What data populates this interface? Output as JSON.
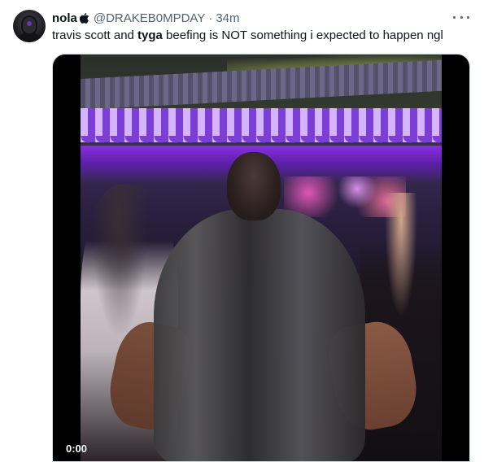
{
  "tweet": {
    "display_name": "nola",
    "badge_icon": "apple-icon",
    "handle": "@DRAKEB0MPDAY",
    "separator": "·",
    "time": "34m",
    "text_before": "travis scott and ",
    "text_bold": "tyga",
    "text_after": " beefing is NOT something i expected to happen ngl",
    "more_icon": "more-horizontal-icon"
  },
  "video": {
    "timestamp": "0:00"
  },
  "colors": {
    "text_primary": "#0f1419",
    "text_secondary": "#536471",
    "border": "#cfd9de",
    "video_bg": "#000000"
  }
}
